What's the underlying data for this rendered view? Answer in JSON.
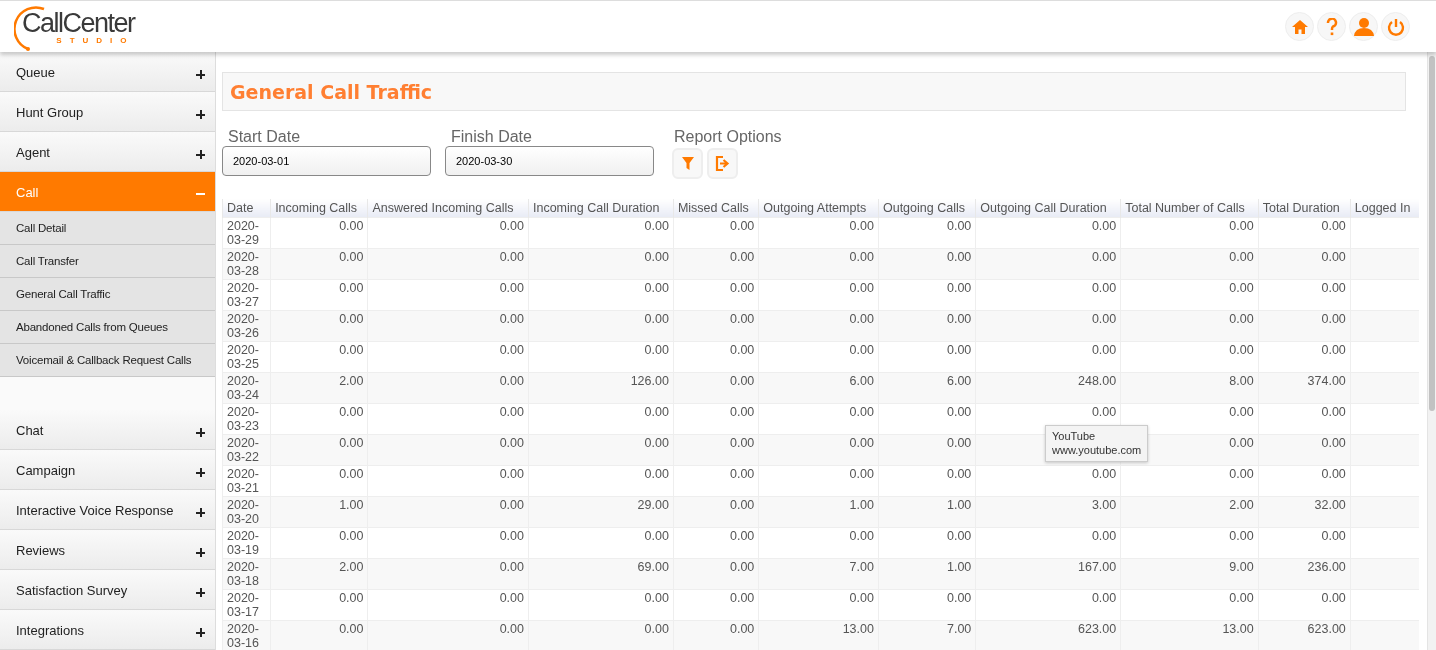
{
  "logo": {
    "name": "CallCenter",
    "tagline": "STUDIO"
  },
  "sidebar": {
    "items": [
      {
        "label": "Queue",
        "expanded": false
      },
      {
        "label": "Hunt Group",
        "expanded": false
      },
      {
        "label": "Agent",
        "expanded": false
      },
      {
        "label": "Call",
        "expanded": true,
        "children": [
          {
            "label": "Call Detail"
          },
          {
            "label": "Call Transfer"
          },
          {
            "label": "General Call Traffic"
          },
          {
            "label": "Abandoned Calls from Queues"
          },
          {
            "label": "Voicemail & Callback Request Calls"
          }
        ]
      },
      {
        "label": "Chat",
        "expanded": false
      },
      {
        "label": "Campaign",
        "expanded": false
      },
      {
        "label": "Interactive Voice Response",
        "expanded": false
      },
      {
        "label": "Reviews",
        "expanded": false
      },
      {
        "label": "Satisfaction Survey",
        "expanded": false
      },
      {
        "label": "Integrations",
        "expanded": false
      }
    ]
  },
  "page_title": "General Call Traffic",
  "filters": {
    "start_label": "Start Date",
    "start_value": "2020-03-01",
    "finish_label": "Finish Date",
    "finish_value": "2020-03-30",
    "options_label": "Report Options"
  },
  "table": {
    "columns": [
      "Date",
      "Incoming Calls",
      "Answered Incoming Calls",
      "Incoming Call Duration",
      "Missed Calls",
      "Outgoing Attempts",
      "Outgoing Calls",
      "Outgoing Call Duration",
      "Total Number of Calls",
      "Total Duration",
      "Logged In"
    ],
    "rows": [
      [
        "2020-03-29",
        "0.00",
        "0.00",
        "0.00",
        "0.00",
        "0.00",
        "0.00",
        "0.00",
        "0.00",
        "0.00"
      ],
      [
        "2020-03-28",
        "0.00",
        "0.00",
        "0.00",
        "0.00",
        "0.00",
        "0.00",
        "0.00",
        "0.00",
        "0.00"
      ],
      [
        "2020-03-27",
        "0.00",
        "0.00",
        "0.00",
        "0.00",
        "0.00",
        "0.00",
        "0.00",
        "0.00",
        "0.00"
      ],
      [
        "2020-03-26",
        "0.00",
        "0.00",
        "0.00",
        "0.00",
        "0.00",
        "0.00",
        "0.00",
        "0.00",
        "0.00"
      ],
      [
        "2020-03-25",
        "0.00",
        "0.00",
        "0.00",
        "0.00",
        "0.00",
        "0.00",
        "0.00",
        "0.00",
        "0.00"
      ],
      [
        "2020-03-24",
        "2.00",
        "0.00",
        "126.00",
        "0.00",
        "6.00",
        "6.00",
        "248.00",
        "8.00",
        "374.00"
      ],
      [
        "2020-03-23",
        "0.00",
        "0.00",
        "0.00",
        "0.00",
        "0.00",
        "0.00",
        "0.00",
        "0.00",
        "0.00"
      ],
      [
        "2020-03-22",
        "0.00",
        "0.00",
        "0.00",
        "0.00",
        "0.00",
        "0.00",
        "",
        "0.00",
        "0.00"
      ],
      [
        "2020-03-21",
        "0.00",
        "0.00",
        "0.00",
        "0.00",
        "0.00",
        "0.00",
        "0.00",
        "0.00",
        "0.00"
      ],
      [
        "2020-03-20",
        "1.00",
        "0.00",
        "29.00",
        "0.00",
        "1.00",
        "1.00",
        "3.00",
        "2.00",
        "32.00"
      ],
      [
        "2020-03-19",
        "0.00",
        "0.00",
        "0.00",
        "0.00",
        "0.00",
        "0.00",
        "0.00",
        "0.00",
        "0.00"
      ],
      [
        "2020-03-18",
        "2.00",
        "0.00",
        "69.00",
        "0.00",
        "7.00",
        "1.00",
        "167.00",
        "9.00",
        "236.00"
      ],
      [
        "2020-03-17",
        "0.00",
        "0.00",
        "0.00",
        "0.00",
        "0.00",
        "0.00",
        "0.00",
        "0.00",
        "0.00"
      ],
      [
        "2020-03-16",
        "0.00",
        "0.00",
        "0.00",
        "0.00",
        "13.00",
        "7.00",
        "623.00",
        "13.00",
        "623.00"
      ]
    ]
  },
  "tooltip": {
    "title": "YouTube",
    "url": "www.youtube.com"
  }
}
